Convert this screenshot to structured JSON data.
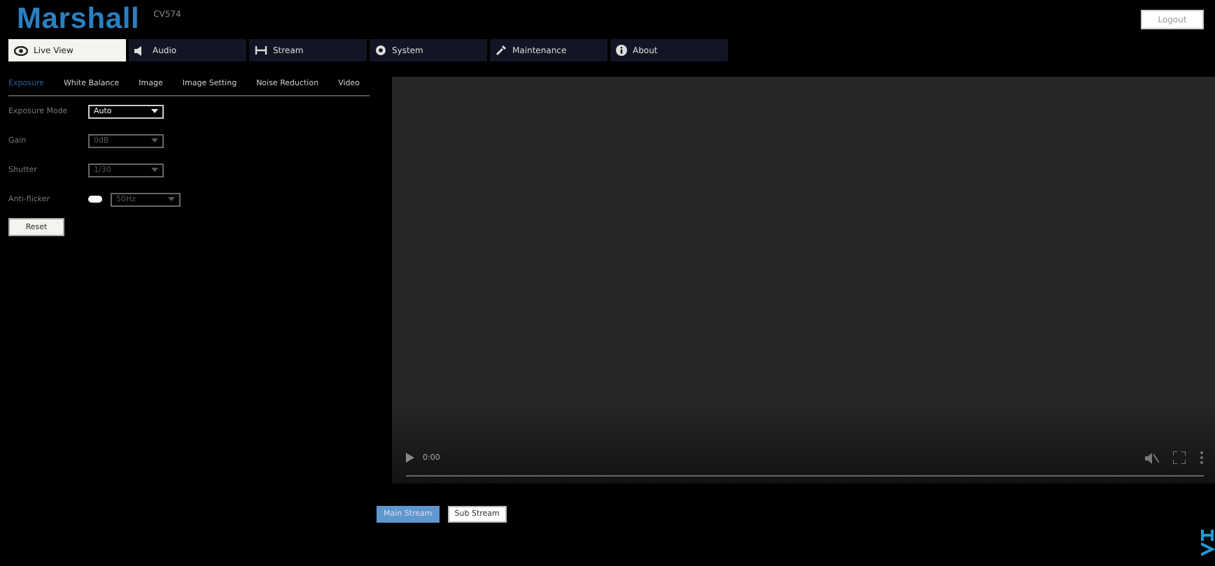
{
  "header": {
    "logo": "Marshall",
    "model": "CV574",
    "logout": "Logout"
  },
  "nav": [
    {
      "label": "Live View",
      "selected": true
    },
    {
      "label": "Audio",
      "selected": false
    },
    {
      "label": "Stream",
      "selected": false
    },
    {
      "label": "System",
      "selected": false
    },
    {
      "label": "Maintenance",
      "selected": false
    },
    {
      "label": "About",
      "selected": false
    }
  ],
  "settings_tabs": [
    {
      "label": "Exposure",
      "selected": true
    },
    {
      "label": "White Balance",
      "selected": false
    },
    {
      "label": "Image",
      "selected": false
    },
    {
      "label": "Image Setting",
      "selected": false
    },
    {
      "label": "Noise Reduction",
      "selected": false
    },
    {
      "label": "Video",
      "selected": false
    }
  ],
  "settings": [
    {
      "kind": "select",
      "label": "Exposure Mode",
      "value": "Auto",
      "disabled": false
    },
    {
      "kind": "select",
      "label": "Gain",
      "value": "0dB",
      "disabled": true
    },
    {
      "kind": "select",
      "label": "Shutter",
      "value": "1/30",
      "disabled": true
    },
    {
      "kind": "toggle",
      "label": "Anti-flicker",
      "on": true,
      "value": "50Hz",
      "disabled": true
    }
  ],
  "reset": "Reset",
  "player": {
    "time": "0:00"
  },
  "streams": [
    {
      "label": "Main Stream",
      "selected": true
    },
    {
      "label": "Sub Stream",
      "selected": false
    }
  ]
}
